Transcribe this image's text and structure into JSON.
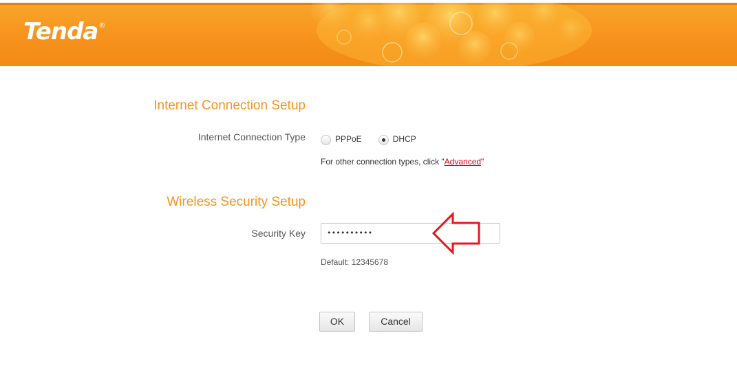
{
  "header": {
    "logo_text": "Tenda",
    "logo_mark": "®",
    "brand_color": "#f7931e"
  },
  "internet": {
    "title": "Internet Connection Setup",
    "type_label": "Internet Connection Type",
    "options": [
      {
        "label": "PPPoE",
        "checked": false
      },
      {
        "label": "DHCP",
        "checked": true
      }
    ],
    "hint_prefix": "For other connection types, click \"",
    "hint_link": "Advanced",
    "hint_suffix": "\""
  },
  "wireless": {
    "title": "Wireless Security Setup",
    "key_label": "Security Key",
    "key_value": "••••••••••",
    "default_text": "Default: 12345678"
  },
  "buttons": {
    "ok": "OK",
    "cancel": "Cancel"
  },
  "annotation": {
    "arrow_color": "#e8141e",
    "arrow_icon": "left-arrow-outline"
  }
}
